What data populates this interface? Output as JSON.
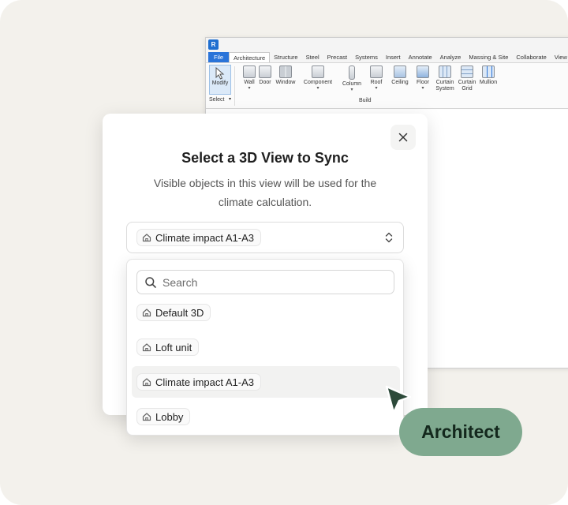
{
  "revit": {
    "app_logo": "R",
    "tabs": [
      "File",
      "Architecture",
      "Structure",
      "Steel",
      "Precast",
      "Systems",
      "Insert",
      "Annotate",
      "Analyze",
      "Massing & Site",
      "Collaborate",
      "View"
    ],
    "tools": {
      "modify": "Modify",
      "wall": "Wall",
      "door": "Door",
      "window": "Window",
      "component": "Component",
      "column": "Column",
      "roof": "Roof",
      "ceiling": "Ceiling",
      "floor": "Floor",
      "curtain_system": "Curtain System",
      "curtain_grid": "Curtain Grid",
      "mullion": "Mullion"
    },
    "panel_select": "Select",
    "panel_build": "Build"
  },
  "dialog": {
    "title": "Select a 3D View to Sync",
    "description": "Visible objects in this view will be used for the climate calculation.",
    "selected_view": "Climate impact A1-A3"
  },
  "dropdown": {
    "search_placeholder": "Search",
    "options": [
      {
        "label": "Default 3D",
        "highlighted": false
      },
      {
        "label": "Loft unit",
        "highlighted": false
      },
      {
        "label": "Climate impact A1-A3",
        "highlighted": true
      },
      {
        "label": "Lobby",
        "highlighted": false
      }
    ]
  },
  "badge": {
    "label": "Architect",
    "color": "#7fa98f"
  },
  "colors": {
    "background": "#f3f1ec",
    "cursor": "#2d4a3a",
    "revit_blue": "#2a74d9"
  }
}
